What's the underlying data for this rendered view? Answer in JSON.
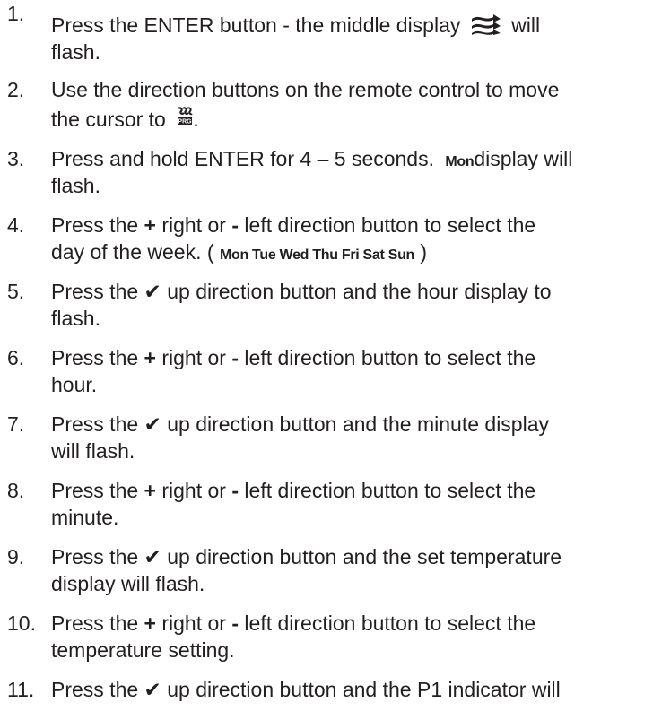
{
  "steps": [
    {
      "number": "1.",
      "parts": {
        "a": "Press the ENTER button - the middle display",
        "b": "will",
        "c": "flash."
      },
      "icon": "fan-speed-icon"
    },
    {
      "number": "2.",
      "parts": {
        "a": "Use the direction buttons on the remote control to move",
        "b": "the cursor to",
        "c": "."
      },
      "icon": "schedule-program-icon"
    },
    {
      "number": "3.",
      "parts": {
        "a": "Press and hold ENTER for 4 – 5 seconds.",
        "mon": "Mon",
        "b": "display will",
        "c": "flash."
      }
    },
    {
      "number": "4.",
      "parts": {
        "a": "Press the",
        "plus": "+",
        "b": "right or",
        "minus": "-",
        "c": "left direction button to select the",
        "d": "day of the week.  (",
        "days": "Mon Tue Wed Thu Fri Sat Sun",
        "e": ")"
      }
    },
    {
      "number": "5.",
      "parts": {
        "a": "Press the",
        "check": "✔",
        "b": "up direction button and the hour display to",
        "c": "flash."
      }
    },
    {
      "number": "6.",
      "parts": {
        "a": "Press the",
        "plus": "+",
        "b": "right or",
        "minus": "-",
        "c": "left direction button to select the",
        "d": "hour."
      }
    },
    {
      "number": "7.",
      "parts": {
        "a": "Press the",
        "check": "✔",
        "b": "up direction button and the minute display",
        "c": "will flash."
      }
    },
    {
      "number": "8.",
      "parts": {
        "a": "Press the",
        "plus": "+",
        "b": "right or",
        "minus": "-",
        "c": "left direction button to select the",
        "d": "minute."
      }
    },
    {
      "number": "9.",
      "parts": {
        "a": "Press the",
        "check": "✔",
        "b": "up direction button and the set temperature",
        "c": "display will flash."
      }
    },
    {
      "number": "10.",
      "parts": {
        "a": "Press the",
        "plus": "+",
        "b": "right or",
        "minus": "-",
        "c": "left direction button to select the",
        "d": "temperature setting."
      }
    },
    {
      "number": "11.",
      "parts": {
        "a": "Press the",
        "check": "✔",
        "b": "up direction button and the P1 indicator will"
      }
    }
  ]
}
